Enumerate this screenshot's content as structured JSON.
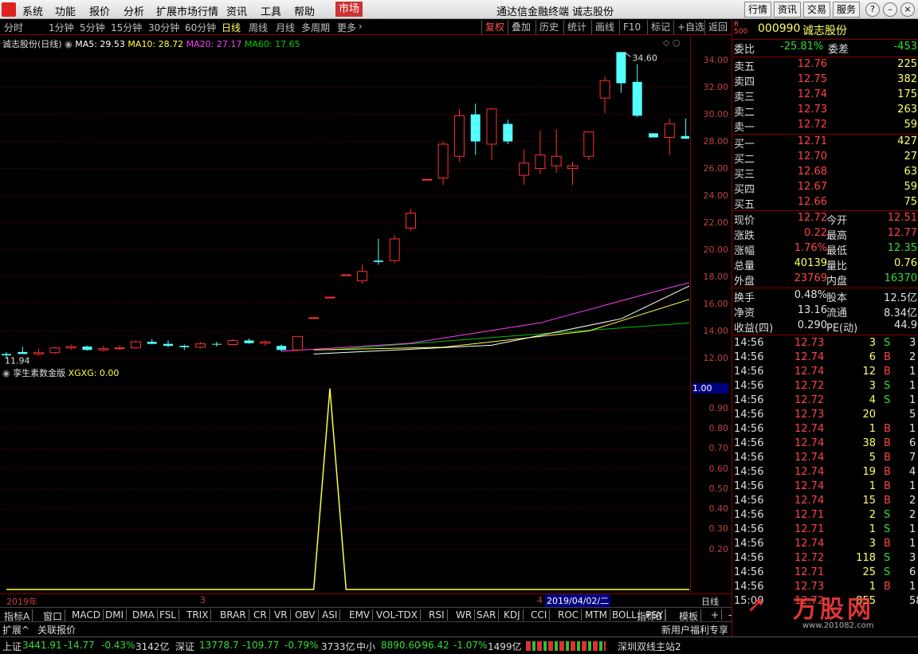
{
  "menu": {
    "items": [
      "系统",
      "功能",
      "报价",
      "分析",
      "扩展市场行情",
      "资讯",
      "工具",
      "帮助",
      "市场"
    ],
    "title": "通达信金融终端 诚志股份",
    "right_buttons": [
      "行情",
      "资讯",
      "交易",
      "服务"
    ]
  },
  "period": {
    "items": [
      "分时",
      "1分钟",
      "5分钟",
      "15分钟",
      "30分钟",
      "60分钟",
      "日线",
      "周线",
      "月线",
      "多周期",
      "更多"
    ],
    "tools": [
      "复权",
      "叠加",
      "历史",
      "统计",
      "画线",
      "F10",
      "标记",
      "+自选",
      "返回"
    ]
  },
  "legend": {
    "name": "诚志股份(日线)",
    "ma5": "MA5: 29.53",
    "ma10": "MA10: 28.72",
    "ma20": "MA20: 27.17",
    "ma60": "MA60: 17.65"
  },
  "indicator": {
    "name": "孪生素数金版",
    "value": "XGXG: 0.00"
  },
  "colors": {
    "up": "#ff3030",
    "down": "#54ffff",
    "ma5": "#ffffff",
    "ma10": "#ffff40",
    "ma20": "#ff40ff",
    "ma60": "#00c000"
  },
  "chart_data": [
    {
      "type": "candlestick",
      "title": "诚志股份(日线)",
      "ylim": [
        11.5,
        35.8
      ],
      "yticks": [
        "34.00",
        "32.00",
        "30.00",
        "28.00",
        "26.00",
        "24.00",
        "22.00",
        "20.00",
        "18.00",
        "16.00",
        "14.00",
        "12.00"
      ],
      "annotations": {
        "high": "34.60",
        "low": "11.94"
      },
      "candles": [
        [
          12.3,
          12.45,
          11.94,
          12.2
        ],
        [
          12.45,
          12.85,
          12.35,
          12.3
        ],
        [
          12.3,
          12.7,
          12.2,
          12.4
        ],
        [
          12.4,
          12.85,
          12.3,
          12.75
        ],
        [
          12.75,
          13.0,
          12.6,
          12.85
        ],
        [
          12.85,
          12.9,
          12.55,
          12.6
        ],
        [
          12.6,
          12.9,
          12.5,
          12.7
        ],
        [
          12.7,
          12.95,
          12.6,
          12.75
        ],
        [
          12.75,
          13.3,
          12.7,
          13.2
        ],
        [
          13.2,
          13.4,
          13.0,
          13.05
        ],
        [
          13.05,
          13.3,
          12.8,
          12.9
        ],
        [
          12.9,
          13.0,
          12.6,
          12.8
        ],
        [
          12.8,
          13.2,
          12.7,
          13.05
        ],
        [
          13.05,
          13.2,
          12.85,
          13.0
        ],
        [
          13.0,
          13.4,
          12.95,
          13.3
        ],
        [
          13.3,
          13.45,
          13.05,
          13.1
        ],
        [
          13.1,
          13.3,
          12.9,
          13.2
        ],
        [
          12.9,
          13.0,
          12.5,
          12.6
        ],
        [
          12.6,
          13.6,
          12.5,
          13.6
        ],
        [
          14.98,
          14.98,
          14.98,
          14.98
        ],
        [
          16.5,
          16.5,
          16.5,
          16.5
        ],
        [
          18.15,
          18.15,
          18.15,
          18.15
        ],
        [
          17.7,
          18.9,
          17.5,
          18.4
        ],
        [
          19.2,
          20.8,
          18.9,
          19.1
        ],
        [
          19.2,
          21.1,
          19.0,
          20.8
        ],
        [
          21.6,
          23.0,
          21.4,
          22.7
        ],
        [
          25.2,
          25.2,
          25.2,
          25.2
        ],
        [
          25.3,
          28.0,
          24.8,
          27.8
        ],
        [
          26.9,
          30.4,
          26.5,
          29.9
        ],
        [
          30.0,
          30.8,
          27.0,
          28.0
        ],
        [
          27.8,
          30.5,
          26.6,
          30.4
        ],
        [
          29.3,
          29.6,
          27.8,
          28.0
        ],
        [
          25.5,
          27.4,
          24.8,
          26.4
        ],
        [
          26.0,
          28.8,
          25.6,
          27.0
        ],
        [
          26.2,
          28.9,
          25.7,
          26.9
        ],
        [
          26.0,
          26.5,
          24.8,
          26.2
        ],
        [
          26.9,
          28.4,
          26.6,
          28.7
        ],
        [
          31.2,
          32.8,
          30.1,
          32.5
        ],
        [
          34.6,
          34.6,
          31.6,
          32.3
        ],
        [
          32.4,
          33.7,
          29.8,
          29.9
        ],
        [
          28.6,
          28.6,
          28.3,
          28.3
        ],
        [
          28.3,
          29.7,
          27.0,
          29.3
        ],
        [
          28.4,
          29.7,
          28.2,
          28.2
        ]
      ],
      "ma5": [
        [
          12.3,
          19
        ],
        [
          12.95,
          30
        ],
        [
          14.9,
          38
        ],
        [
          17.2,
          42
        ],
        [
          20.6,
          48
        ],
        [
          24.9,
          54
        ],
        [
          28.6,
          60
        ],
        [
          29.8,
          62
        ],
        [
          27.5,
          66
        ],
        [
          27.7,
          72
        ],
        [
          29.7,
          78
        ],
        [
          30.3,
          82
        ],
        [
          30.1,
          84
        ],
        [
          29.4,
          87
        ]
      ],
      "ma10": [
        [
          12.6,
          19
        ],
        [
          12.8,
          27
        ],
        [
          14.0,
          36
        ],
        [
          17.0,
          44
        ],
        [
          21.0,
          50
        ],
        [
          24.8,
          56
        ],
        [
          27.0,
          62
        ],
        [
          27.9,
          68
        ],
        [
          27.5,
          71
        ],
        [
          28.3,
          78
        ],
        [
          28.7,
          84
        ],
        [
          28.7,
          87
        ]
      ],
      "ma20": [
        [
          12.5,
          17
        ],
        [
          13.1,
          25
        ],
        [
          14.6,
          33
        ],
        [
          17.2,
          41
        ],
        [
          19.9,
          50
        ],
        [
          22.3,
          58
        ],
        [
          24.5,
          66
        ],
        [
          25.9,
          74
        ],
        [
          27.2,
          87
        ]
      ],
      "ma60": [
        [
          12.6,
          20
        ],
        [
          13.7,
          32
        ],
        [
          15.1,
          48
        ],
        [
          16.2,
          62
        ],
        [
          17.65,
          87
        ]
      ]
    },
    {
      "type": "line",
      "title": "孪生素数金版 XGXG",
      "ylim": [
        0,
        1.05
      ],
      "yticks": [
        "1.00",
        "0.90",
        "0.80",
        "0.70",
        "0.60",
        "0.50",
        "0.40",
        "0.30",
        "0.20"
      ],
      "series": [
        {
          "name": "XGXG",
          "values": [
            [
              0,
              0
            ],
            [
              19,
              0
            ],
            [
              20,
              1
            ],
            [
              21,
              0
            ],
            [
              47,
              0
            ]
          ]
        }
      ]
    }
  ],
  "datebar": {
    "year": "2019年",
    "mid": "3",
    "end": "4",
    "cursor": "2019/04/02/二",
    "right": "日线"
  },
  "tabs": [
    "指标A",
    "窗口",
    "MACD",
    "DMI",
    "DMA",
    "FSL",
    "TRIX",
    "BRAR",
    "CR",
    "VR",
    "OBV",
    "ASI",
    "EMV",
    "VOL-TDX",
    "RSI",
    "WR",
    "SAR",
    "KDJ",
    "CCI",
    "ROC",
    "MTM",
    "BOLL",
    "PSY"
  ],
  "tabs_right": [
    "指标B",
    "模板",
    "+",
    "-"
  ],
  "ext": {
    "left": "扩展^",
    "right": "关联报价",
    "promo": "新用户福利专享"
  },
  "quote": {
    "code": "000990",
    "name": "诚志股份",
    "webi": {
      "label": "委比",
      "value": "-25.81%",
      "label2": "委差",
      "value2": "-453"
    },
    "asks": [
      [
        "卖五",
        "12.76",
        "225"
      ],
      [
        "卖四",
        "12.75",
        "382"
      ],
      [
        "卖三",
        "12.74",
        "175"
      ],
      [
        "卖二",
        "12.73",
        "263"
      ],
      [
        "卖一",
        "12.72",
        "59"
      ]
    ],
    "bids": [
      [
        "买一",
        "12.71",
        "427"
      ],
      [
        "买二",
        "12.70",
        "27"
      ],
      [
        "买三",
        "12.68",
        "63"
      ],
      [
        "买四",
        "12.67",
        "59"
      ],
      [
        "买五",
        "12.66",
        "75"
      ]
    ],
    "stats": [
      [
        "现价",
        "12.72",
        "今开",
        "12.51"
      ],
      [
        "涨跌",
        "0.22",
        "最高",
        "12.77"
      ],
      [
        "涨幅",
        "1.76%",
        "最低",
        "12.35"
      ],
      [
        "总量",
        "40139",
        "量比",
        "0.76"
      ],
      [
        "外盘",
        "23769",
        "内盘",
        "16370"
      ]
    ],
    "stats2": [
      [
        "换手",
        "0.48%",
        "股本",
        "12.5亿"
      ],
      [
        "净资",
        "13.16",
        "流通",
        "8.34亿"
      ],
      [
        "收益(四)",
        "0.290",
        "PE(动)",
        "44.9"
      ]
    ],
    "ticks": [
      [
        "14:56",
        "12.73",
        "3",
        "S",
        "3"
      ],
      [
        "14:56",
        "12.74",
        "6",
        "B",
        "2"
      ],
      [
        "14:56",
        "12.74",
        "12",
        "B",
        "1"
      ],
      [
        "14:56",
        "12.72",
        "3",
        "S",
        "1"
      ],
      [
        "14:56",
        "12.72",
        "4",
        "S",
        "1"
      ],
      [
        "14:56",
        "12.73",
        "20",
        "",
        "5"
      ],
      [
        "14:56",
        "12.74",
        "1",
        "B",
        "1"
      ],
      [
        "14:56",
        "12.74",
        "38",
        "B",
        "6"
      ],
      [
        "14:56",
        "12.74",
        "5",
        "B",
        "7"
      ],
      [
        "14:56",
        "12.74",
        "19",
        "B",
        "4"
      ],
      [
        "14:56",
        "12.74",
        "1",
        "B",
        "1"
      ],
      [
        "14:56",
        "12.74",
        "15",
        "B",
        "2"
      ],
      [
        "14:56",
        "12.71",
        "2",
        "S",
        "2"
      ],
      [
        "14:56",
        "12.71",
        "1",
        "S",
        "1"
      ],
      [
        "14:56",
        "12.74",
        "3",
        "B",
        "1"
      ],
      [
        "14:56",
        "12.72",
        "118",
        "S",
        "3"
      ],
      [
        "14:56",
        "12.71",
        "25",
        "S",
        "6"
      ],
      [
        "14:56",
        "12.73",
        "1",
        "B",
        "1"
      ],
      [
        "15:00",
        "12.72",
        "855",
        "",
        "58"
      ]
    ]
  },
  "status": {
    "sh": "上证",
    "sh_v": "3441.91",
    "sh_c": "-14.77",
    "sh_p": "-0.43%",
    "sh_a": "3142亿",
    "sz": "深证",
    "sz_v": "13778.7",
    "sz_c": "-109.77",
    "sz_p": "-0.79%",
    "sz_a": "3733亿",
    "zx": "中小",
    "zx_v": "8890.60",
    "zx_c": "-96.42",
    "zx_p": "-1.07%",
    "zx_a": "1499亿",
    "server": "深圳双线主站2"
  },
  "watermark": {
    "text": "万股网",
    "url": "www.201082.com"
  }
}
